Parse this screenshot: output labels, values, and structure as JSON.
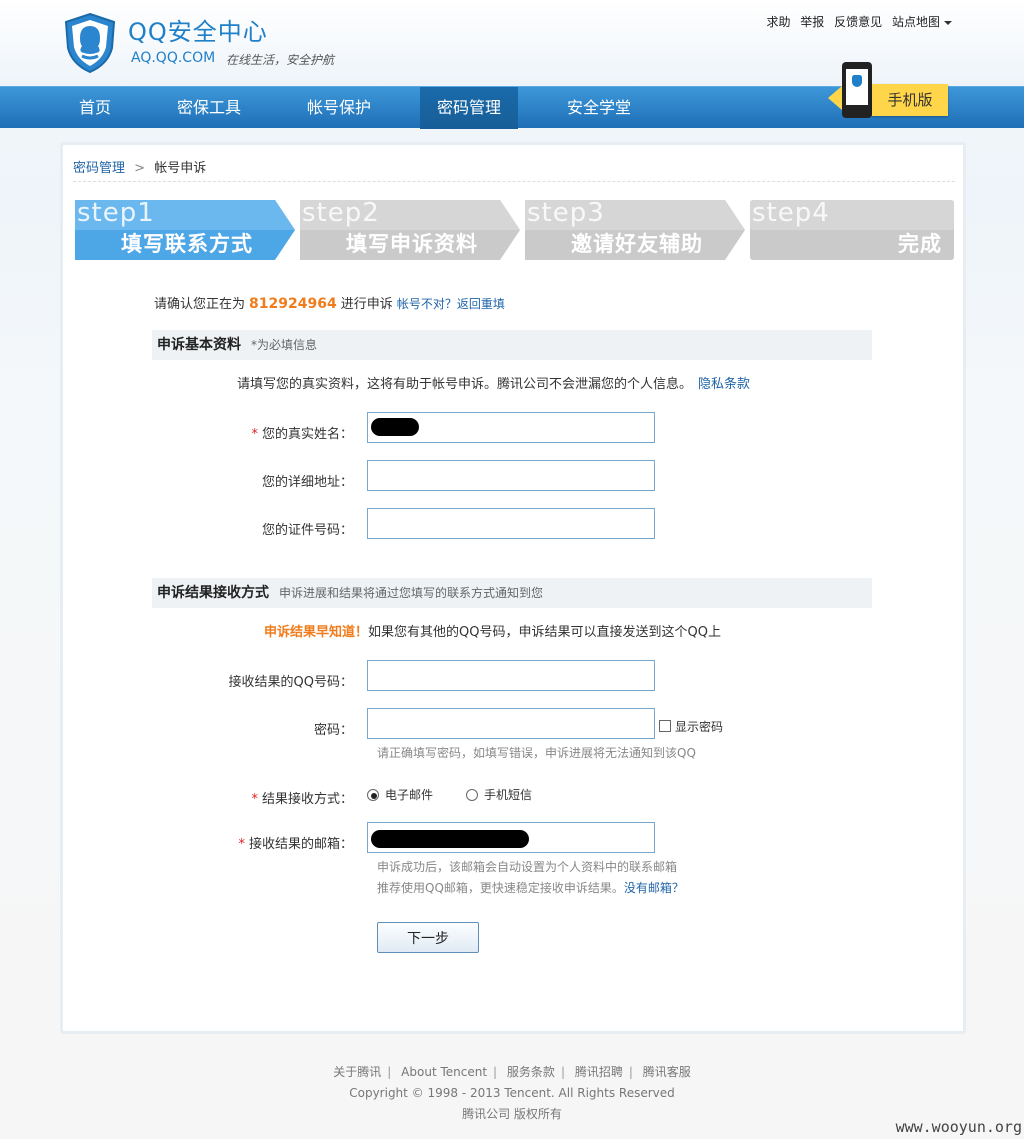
{
  "header": {
    "logo_title": "QQ安全中心",
    "logo_domain": "AQ.QQ.COM",
    "logo_slogan": "在线生活，安全护航",
    "toplinks": [
      "求助",
      "举报",
      "反馈意见",
      "站点地图"
    ]
  },
  "nav": {
    "items": [
      "首页",
      "密保工具",
      "帐号保护",
      "密码管理",
      "安全学堂"
    ],
    "active": "密码管理",
    "mobile_label": "手机版"
  },
  "breadcrumb": {
    "parent": "密码管理",
    "separator": ">",
    "current": "帐号申诉"
  },
  "steps": [
    {
      "num": "step1",
      "title": "填写联系方式",
      "active": true
    },
    {
      "num": "step2",
      "title": "填写申诉资料",
      "active": false
    },
    {
      "num": "step3",
      "title": "邀请好友辅助",
      "active": false
    },
    {
      "num": "step4",
      "title": "完成",
      "active": false
    }
  ],
  "confirm": {
    "prefix": "请确认您正在为",
    "qq": "812924964",
    "suffix": "进行申诉",
    "link": "帐号不对？返回重填"
  },
  "section1": {
    "title": "申诉基本资料",
    "required_note": "*为必填信息",
    "hint": "请填写您的真实资料，这将有助于帐号申诉。腾讯公司不会泄漏您的个人信息。",
    "privacy_link": "隐私条款",
    "fields": {
      "name_label": "您的真实姓名：",
      "address_label": "您的详细地址：",
      "id_label": "您的证件号码："
    }
  },
  "section2": {
    "title": "申诉结果接收方式",
    "subtitle": "申诉进展和结果将通过您填写的联系方式通知到您",
    "promo_highlight": "申诉结果早知道！",
    "promo_text": "如果您有其他的QQ号码，申诉结果可以直接发送到这个QQ上",
    "qq_label": "接收结果的QQ号码：",
    "password_label": "密码：",
    "show_password": "显示密码",
    "password_note": "请正确填写密码，如填写错误，申诉进展将无法通知到该QQ",
    "method_label": "结果接收方式：",
    "method_options": [
      "电子邮件",
      "手机短信"
    ],
    "method_selected": "电子邮件",
    "email_label": "接收结果的邮箱：",
    "email_note_1": "申诉成功后，该邮箱会自动设置为个人资料中的联系邮箱",
    "email_note_2": "推荐使用QQ邮箱，更快速稳定接收申诉结果。",
    "no_email_link": "没有邮箱？"
  },
  "next_button": "下一步",
  "footer": {
    "links": [
      "关于腾讯",
      "About Tencent",
      "服务条款",
      "腾讯招聘",
      "腾讯客服"
    ],
    "copyright": "Copyright © 1998 - 2013 Tencent. All Rights Reserved",
    "company": "腾讯公司 版权所有"
  },
  "watermark": "www.wooyun.org",
  "colors": {
    "brand_blue": "#1f7fc8",
    "nav_blue": "#2a82c8",
    "step_active": "#4aa3e3",
    "step_inactive": "#cfcfcf",
    "highlight_orange": "#f07c1c",
    "required_red": "#dd2222"
  }
}
